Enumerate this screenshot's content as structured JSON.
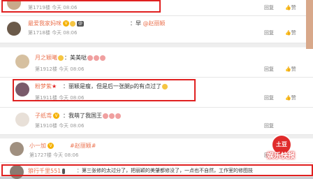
{
  "comments": [
    {
      "floor": "第1719楼",
      "time": "今天 08:06",
      "reply": "回复",
      "like": "赞",
      "highlighted": true
    },
    {
      "username": "最爱我家妈咪",
      "tag": "@",
      "content": "：早",
      "mention": "@赵丽颖",
      "floor": "第1718楼",
      "time": "今天 08:06",
      "reply": "回复",
      "like": "赞"
    },
    {
      "username": "月之颖曦",
      "content": "：美美哒",
      "floor": "第1912楼",
      "time": "今天 08:06",
      "reply": "回复",
      "like": "赞"
    },
    {
      "username": "粉梦紫",
      "content": "：丽颖是瘦，但是后一张腿p的有点过了",
      "floor": "第1911楼",
      "time": "今天 08:06",
      "reply": "回复",
      "like": "赞",
      "highlighted": true
    },
    {
      "username": "子纸鸢",
      "content": "：我萌了我国王",
      "floor": "第1910楼",
      "time": "今天 08:06",
      "reply": "回复",
      "like": "赞"
    },
    {
      "username": "小一加",
      "mention": "#赵丽颖#",
      "floor": "第1727楼",
      "time": "今天 08:06",
      "reply": "回复",
      "like": "赞"
    },
    {
      "username": "狼行千里551",
      "content": "：第三张修的太过分了，把丽颖的美肇都修没了，一点也不自然，工作室的修图技",
      "highlighted": true
    }
  ],
  "watermark": {
    "circle_text": "土豆",
    "text": "娱乐快报"
  }
}
